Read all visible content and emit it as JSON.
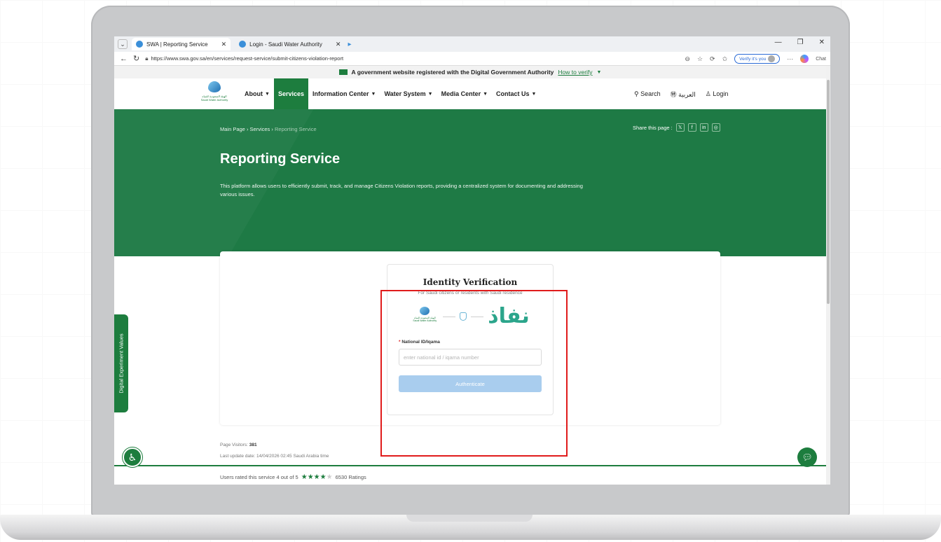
{
  "browser": {
    "tabs": [
      {
        "label": "SWA | Reporting Service",
        "active": true
      },
      {
        "label": "Login - Saudi Water Authority",
        "active": false
      }
    ],
    "url": "https://www.swa.gov.sa/en/services/request-service/submit-citizens-violation-report",
    "verify_label": "Verify it's you",
    "chat_label": "Chat"
  },
  "gov_banner": {
    "text": "A government website registered with the Digital Government Authority",
    "verify_link": "How to verify"
  },
  "header": {
    "logo_text": "الهيئة السعودية للمياه Saudi Water Authority",
    "nav": [
      {
        "label": "About",
        "dropdown": true
      },
      {
        "label": "Services",
        "dropdown": false,
        "active": true
      },
      {
        "label": "Information Center",
        "dropdown": true
      },
      {
        "label": "Water System",
        "dropdown": true
      },
      {
        "label": "Media Center",
        "dropdown": true
      },
      {
        "label": "Contact Us",
        "dropdown": true
      }
    ],
    "search_label": "Search",
    "language_label": "العربية",
    "login_label": "Login"
  },
  "hero": {
    "breadcrumb": [
      "Main Page",
      "Services",
      "Reporting Service"
    ],
    "share_label": "Share this page :",
    "title": "Reporting Service",
    "description": "This platform allows users to efficiently submit, track, and manage Citizens Violation reports, providing a centralized system for documenting and addressing various issues."
  },
  "auth": {
    "title": "Identity Verification",
    "subtitle": "For Saudi citizens or residents with Saudi residence",
    "nafath_logo": "نفاذ",
    "field_label": "National ID/Iqama",
    "placeholder": "enter national id / iqama number",
    "button": "Authenticate"
  },
  "footer": {
    "visitors_label": "Page Visitors:",
    "visitors_count": "381",
    "last_update": "Last update date: 14/04/2026 02:45 Saudi Arabia time",
    "rating_text": "Users rated this service 4 out of 5",
    "rating_value": 4,
    "rating_max": 5,
    "ratings_count": "6530 Ratings"
  },
  "side_tab": "Digital Experiment Values",
  "colors": {
    "brand_green": "#1d7d3e",
    "highlight": "#e01b1b",
    "button_disabled": "#a9cdee"
  }
}
